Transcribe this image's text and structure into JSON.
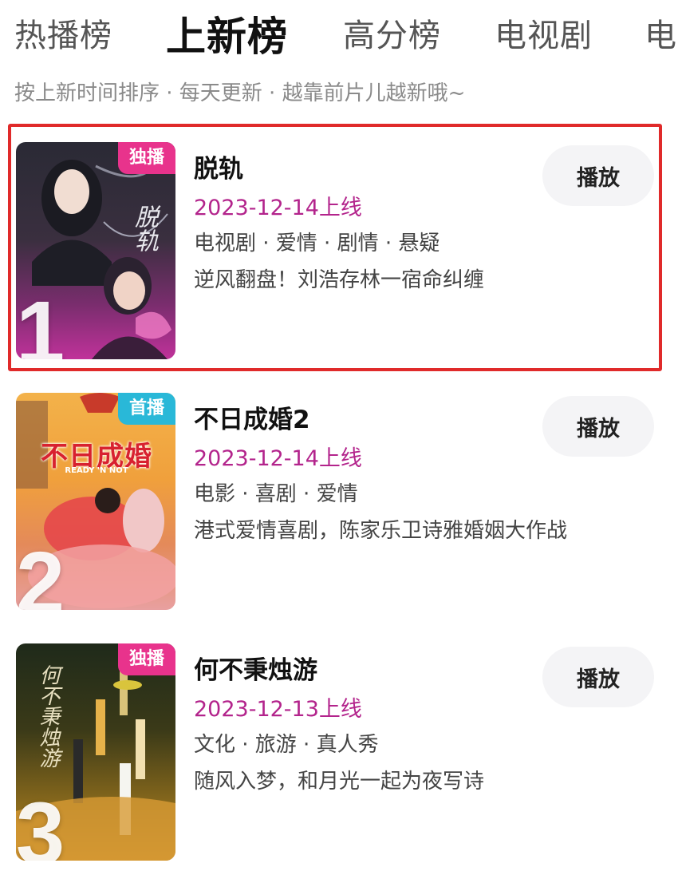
{
  "tabs": [
    {
      "label": "热播榜",
      "active": false
    },
    {
      "label": "上新榜",
      "active": true
    },
    {
      "label": "高分榜",
      "active": false
    },
    {
      "label": "电视剧",
      "active": false
    },
    {
      "label": "电",
      "active": false
    }
  ],
  "subtitle": "按上新时间排序 · 每天更新 · 越靠前片儿越新哦~",
  "items": [
    {
      "rank": "1",
      "badge": "独播",
      "badge_color": "#e8338c",
      "poster_text": "脱轨",
      "title": "脱轨",
      "date": "2023-12-14上线",
      "genres": "电视剧 · 爱情 · 剧情 · 悬疑",
      "description": "逆风翻盘！刘浩存林一宿命纠缠",
      "play_label": "播放"
    },
    {
      "rank": "2",
      "badge": "首播",
      "badge_color": "#29b8d8",
      "poster_text": "不日成婚",
      "poster_subtext": "READY 'N NOT",
      "title": "不日成婚2",
      "date": "2023-12-14上线",
      "genres": "电影 · 喜剧 · 爱情",
      "description": "港式爱情喜剧，陈家乐卫诗雅婚姻大作战",
      "play_label": "播放"
    },
    {
      "rank": "3",
      "badge": "独播",
      "badge_color": "#e8338c",
      "poster_text": "何不秉烛游",
      "title": "何不秉烛游",
      "date": "2023-12-13上线",
      "genres": "文化 · 旅游 · 真人秀",
      "description": "随风入梦，和月光一起为夜写诗",
      "play_label": "播放"
    }
  ],
  "colors": {
    "accent_date": "#b3248c",
    "highlight_border": "#e02a2a"
  }
}
